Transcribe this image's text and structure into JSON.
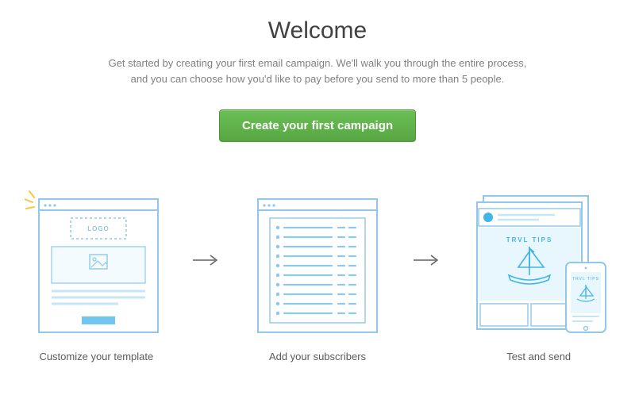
{
  "title": "Welcome",
  "subtitle": "Get started by creating your first email campaign. We'll walk you through the entire process, and you can choose how you'd like to pay before you send to more than 5 people.",
  "cta_label": "Create your first campaign",
  "steps": [
    {
      "label": "Customize your template"
    },
    {
      "label": "Add your subscribers"
    },
    {
      "label": "Test and send"
    }
  ],
  "illus": {
    "logo_text": "LOGO",
    "trvl_text": "TRVL TIPS"
  },
  "colors": {
    "stroke": "#8fc8e9",
    "accent": "#42b4e6",
    "panel_bg": "#f4fbfe",
    "yellow": "#f9c646"
  }
}
